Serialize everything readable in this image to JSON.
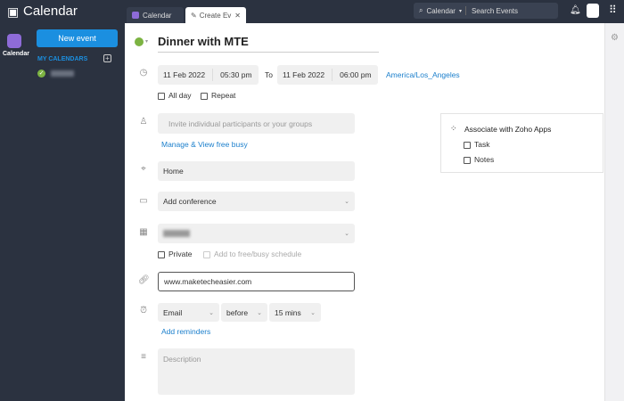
{
  "app": {
    "title": "Calendar"
  },
  "tabs": [
    {
      "label": "Calendar"
    },
    {
      "label": "Create Ev"
    }
  ],
  "search": {
    "scope": "Calendar",
    "placeholder": "Search Events"
  },
  "sidebar": {
    "nav_label": "Calendar",
    "new_event": "New event",
    "my_calendars": "MY CALENDARS"
  },
  "event": {
    "title": "Dinner with MTE",
    "start_date": "11 Feb 2022",
    "start_time": "05:30 pm",
    "to": "To",
    "end_date": "11 Feb 2022",
    "end_time": "06:00 pm",
    "timezone": "America/Los_Angeles",
    "all_day": "All day",
    "repeat": "Repeat",
    "participants_placeholder": "Invite individual participants or your groups",
    "manage_link": "Manage & View free busy",
    "location": "Home",
    "conference": "Add conference",
    "private": "Private",
    "free_busy": "Add to free/busy schedule",
    "url": "www.maketecheasier.com",
    "reminder": {
      "type": "Email",
      "when": "before",
      "amount": "15 mins"
    },
    "add_reminders": "Add reminders",
    "description_placeholder": "Description"
  },
  "associate": {
    "title": "Associate with Zoho Apps",
    "items": [
      "Task",
      "Notes"
    ]
  },
  "colors": {
    "accent": "#1b8fe0",
    "dark": "#2b3240",
    "event": "#7cb342"
  }
}
